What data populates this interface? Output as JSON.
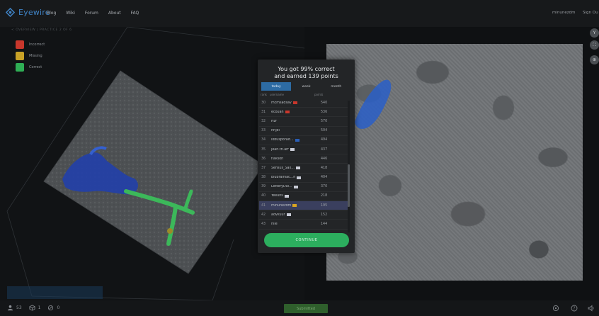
{
  "nav": {
    "brand": "Eyewire",
    "links": [
      "Blog",
      "Wiki",
      "Forum",
      "About",
      "FAQ"
    ],
    "username": "minunezdm",
    "sign_out": "Sign Ou"
  },
  "breadcrumb": "< OVERVIEW | PRACTICE 2 OF 6",
  "legend": [
    {
      "label": "Incorrect",
      "color": "#c8372c"
    },
    {
      "label": "Missing",
      "color": "#c9a227"
    },
    {
      "label": "Correct",
      "color": "#2fae55"
    }
  ],
  "modal": {
    "title_line1": "You got 99% correct",
    "title_line2": "and earned 139 points",
    "tabs": [
      "today",
      "week",
      "month"
    ],
    "active_tab": "today",
    "columns": [
      "rank",
      "username",
      "points"
    ],
    "rows": [
      {
        "rank": "30",
        "user": "mcmsadsav",
        "flag": "#c8372c",
        "points": "540"
      },
      {
        "rank": "31",
        "user": "ecouan",
        "flag": "#c8372c",
        "points": "536"
      },
      {
        "rank": "32",
        "user": "Hzr",
        "flag": "",
        "points": "570"
      },
      {
        "rank": "33",
        "user": "nrijel",
        "flag": "",
        "points": "504"
      },
      {
        "rank": "34",
        "user": "lobusporalt...",
        "flag": "#2a5fb6",
        "points": "494"
      },
      {
        "rank": "35",
        "user": "jean.th.arr",
        "flag": "#c8cbd6",
        "points": "437"
      },
      {
        "rank": "36",
        "user": "flakson",
        "flag": "",
        "points": "446"
      },
      {
        "rank": "37",
        "user": "Sensus_Sax...",
        "flag": "#c8cbd6",
        "points": "418"
      },
      {
        "rank": "38",
        "user": "blubrainiac...h",
        "flag": "#c8cbd6",
        "points": "404"
      },
      {
        "rank": "39",
        "user": "LotteryDal...",
        "flag": "#c8cbd6",
        "points": "370"
      },
      {
        "rank": "40",
        "user": "Yeeuhs",
        "flag": "#c8cbd6",
        "points": "218"
      },
      {
        "rank": "41",
        "user": "minunezdm",
        "flag": "#d9a521",
        "points": "195",
        "me": true
      },
      {
        "rank": "42",
        "user": "advkuur",
        "flag": "#c8cbd6",
        "points": "152"
      },
      {
        "rank": "43",
        "user": "nile",
        "flag": "",
        "points": "144"
      }
    ],
    "continue_label": "CONTINUE"
  },
  "bottom": {
    "players": "53",
    "cubes": "1",
    "points": "0",
    "status_label": "Submitted"
  },
  "side_buttons": [
    "Y",
    "⛶",
    "⊕"
  ],
  "colors": {
    "accent": "#2d6ba3",
    "brand": "#3f82c4",
    "continue": "#2cae5e",
    "highlight_row": "#3a3f5e"
  }
}
